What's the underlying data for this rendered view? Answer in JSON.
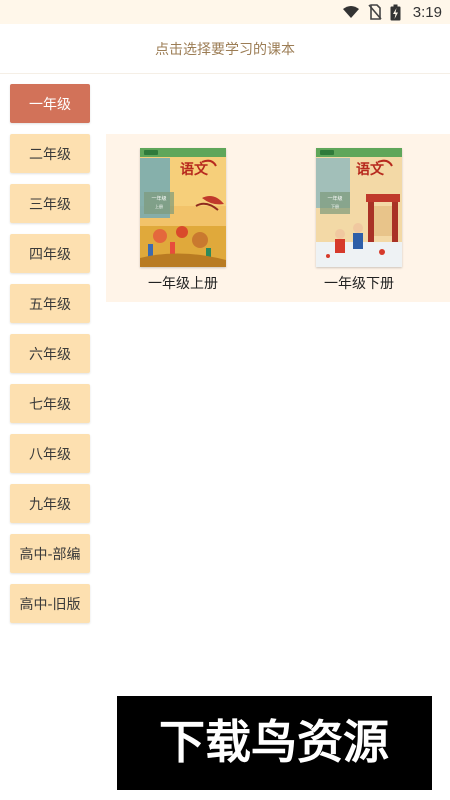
{
  "status_bar": {
    "time": "3:19",
    "icons": [
      "wifi-icon",
      "no-sim-icon",
      "battery-charging-icon"
    ]
  },
  "header": {
    "title": "点击选择要学习的课本"
  },
  "sidebar": {
    "items": [
      {
        "label": "一年级",
        "active": true
      },
      {
        "label": "二年级",
        "active": false
      },
      {
        "label": "三年级",
        "active": false
      },
      {
        "label": "四年级",
        "active": false
      },
      {
        "label": "五年级",
        "active": false
      },
      {
        "label": "六年级",
        "active": false
      },
      {
        "label": "七年级",
        "active": false
      },
      {
        "label": "八年级",
        "active": false
      },
      {
        "label": "九年级",
        "active": false
      },
      {
        "label": "高中-部编",
        "active": false
      },
      {
        "label": "高中-旧版",
        "active": false
      }
    ]
  },
  "books": [
    {
      "title": "一年级上册",
      "cover_title": "语文",
      "cover_grade": "一年级",
      "cover_volume": "上册"
    },
    {
      "title": "一年级下册",
      "cover_title": "语文",
      "cover_grade": "一年级",
      "cover_volume": "下册"
    }
  ],
  "watermark": {
    "text": "下载鸟资源"
  },
  "colors": {
    "accent": "#d27259",
    "button_bg": "#fde0b0",
    "header_text": "#9c7d55",
    "panel_bg": "#fff4e8",
    "status_bg": "#fff7ea"
  }
}
